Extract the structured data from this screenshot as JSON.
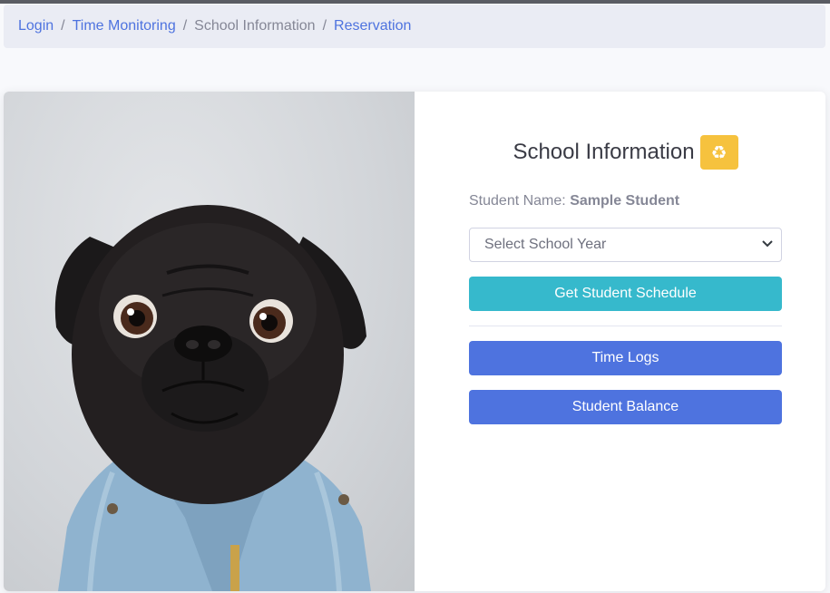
{
  "breadcrumb": {
    "items": [
      {
        "label": "Login",
        "link": true
      },
      {
        "label": "Time Monitoring",
        "link": true
      },
      {
        "label": "School Information",
        "link": false
      },
      {
        "label": "Reservation",
        "link": true
      }
    ],
    "separator": "/"
  },
  "photo": {
    "subject": "pug-in-denim-jacket"
  },
  "panel": {
    "title": "School Information",
    "refresh_icon": "recycle-icon",
    "student_label": "Student Name:",
    "student_name": "Sample Student",
    "school_year_select": {
      "selected": "Select School Year"
    },
    "get_schedule_label": "Get Student Schedule",
    "time_logs_label": "Time Logs",
    "student_balance_label": "Student Balance"
  },
  "colors": {
    "primary": "#4e73df",
    "info": "#36b9cc",
    "warning": "#f6c23e",
    "breadcrumb_bg": "#eaecf4"
  }
}
